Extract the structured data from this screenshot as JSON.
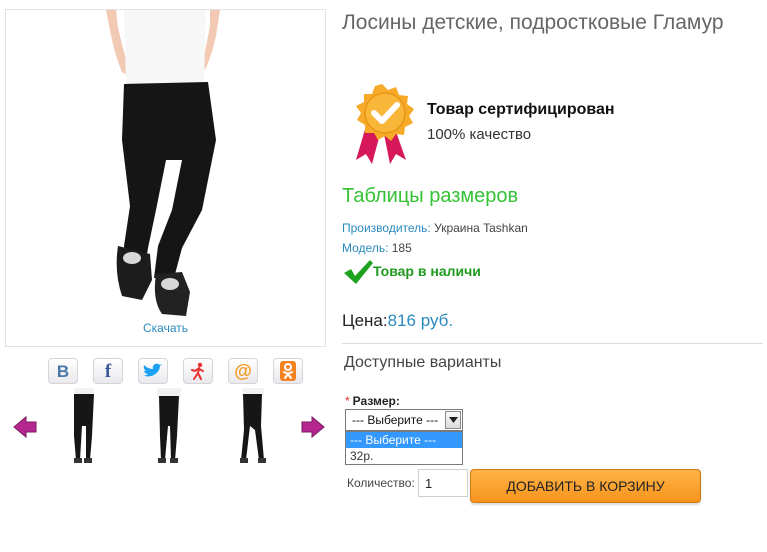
{
  "product": {
    "title": "Лосины детские, подростковые Гламур",
    "download_label": "Скачать",
    "certificate": {
      "title": "Товар сертифицирован",
      "subtitle": "100% качество"
    },
    "size_table_link": "Таблицы размеров",
    "manufacturer": {
      "label": "Производитель:",
      "value": "Украина Tashkan"
    },
    "model": {
      "label": "Модель:",
      "value": "185"
    },
    "stock_status": "Товар в наличи",
    "price": {
      "label": "Цена:",
      "value": "816 руб."
    }
  },
  "social_icons": [
    {
      "name": "vkontakte",
      "glyph": "В",
      "color": "#4a76a8"
    },
    {
      "name": "facebook",
      "glyph": "f",
      "color": "#3b5998"
    },
    {
      "name": "twitter",
      "glyph": "bird",
      "color": "#1da1f2"
    },
    {
      "name": "moikrug",
      "glyph": "person",
      "color": "#e8332f"
    },
    {
      "name": "mailru",
      "glyph": "@",
      "color": "#f59a1c"
    },
    {
      "name": "odnoklassniki",
      "glyph": "ok",
      "color": "#f58220"
    }
  ],
  "variants": {
    "title": "Доступные варианты",
    "size_label": "Размер:",
    "required_marker": "*",
    "selected": "--- Выберите ---",
    "options": [
      "--- Выберите ---",
      "32р."
    ]
  },
  "cart": {
    "quantity_label": "Количество:",
    "quantity_value": "1",
    "add_button": "ДОБАВИТЬ В КОРЗИНУ"
  },
  "colors": {
    "accent_blue": "#2a8bc0",
    "green": "#34c234",
    "orange": "#f7941d",
    "arrow_purple": "#b5278f"
  }
}
